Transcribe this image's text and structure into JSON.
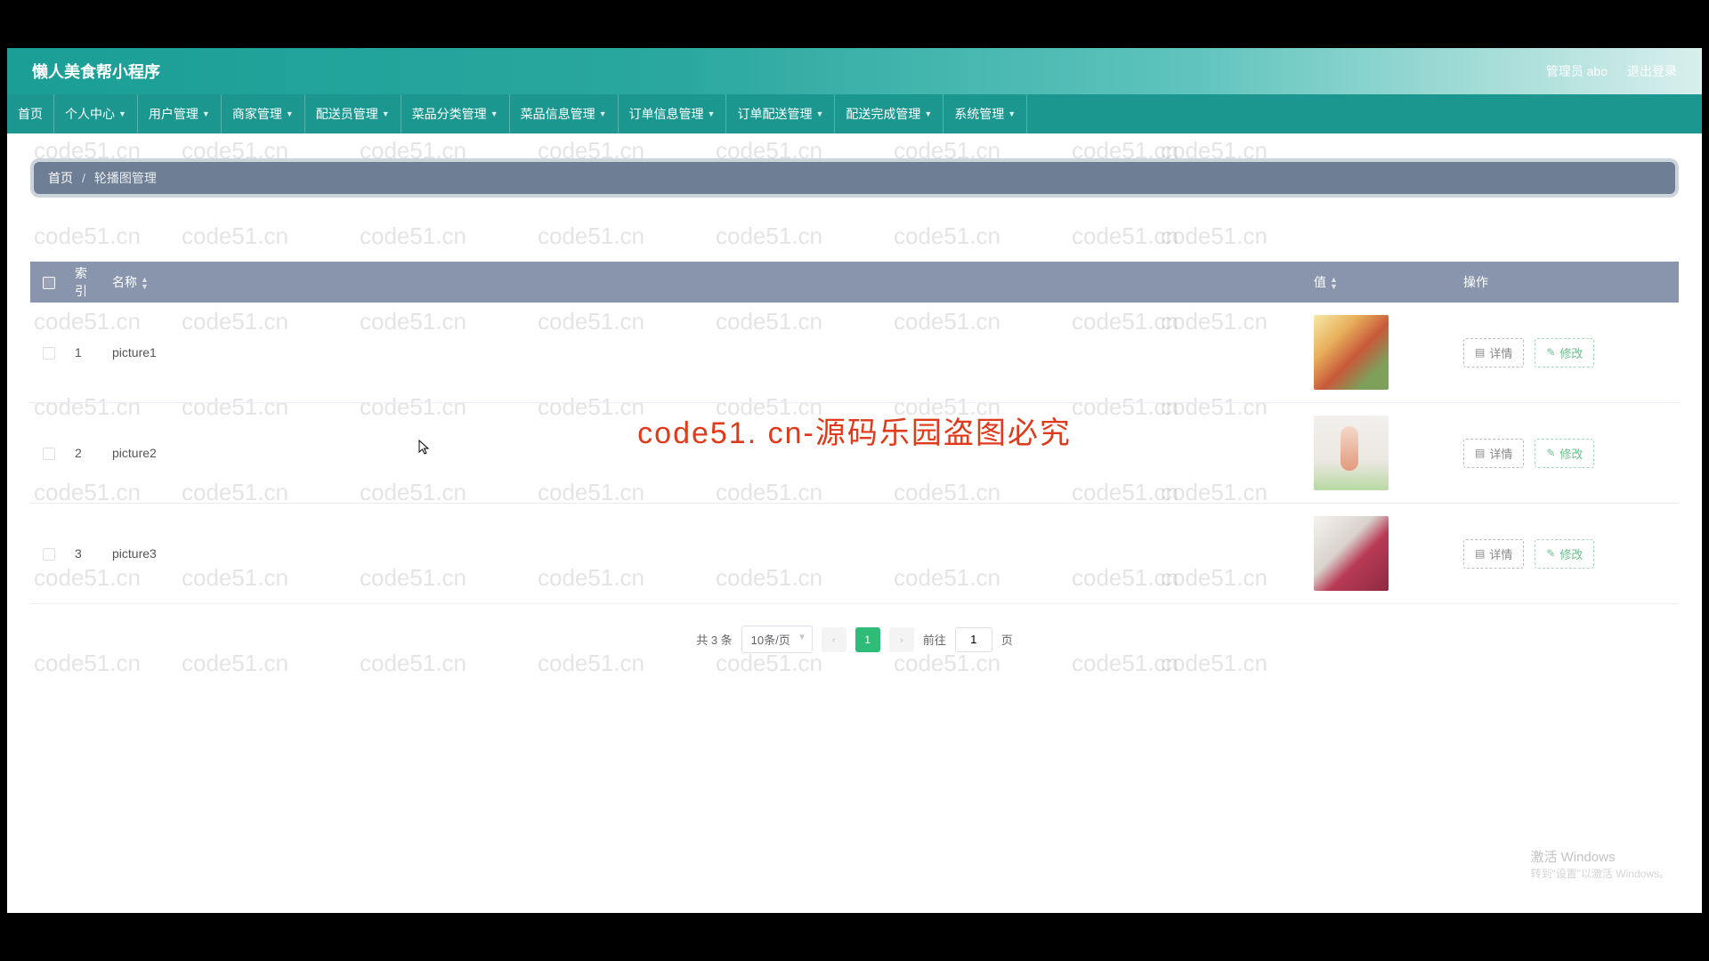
{
  "header": {
    "app_title": "懒人美食帮小程序",
    "admin_label": "管理员 abo",
    "logout": "退出登录"
  },
  "nav": [
    {
      "label": "首页",
      "dropdown": false
    },
    {
      "label": "个人中心",
      "dropdown": true
    },
    {
      "label": "用户管理",
      "dropdown": true
    },
    {
      "label": "商家管理",
      "dropdown": true
    },
    {
      "label": "配送员管理",
      "dropdown": true
    },
    {
      "label": "菜品分类管理",
      "dropdown": true
    },
    {
      "label": "菜品信息管理",
      "dropdown": true
    },
    {
      "label": "订单信息管理",
      "dropdown": true
    },
    {
      "label": "订单配送管理",
      "dropdown": true
    },
    {
      "label": "配送完成管理",
      "dropdown": true
    },
    {
      "label": "系统管理",
      "dropdown": true
    }
  ],
  "breadcrumb": {
    "home": "首页",
    "sep": "/",
    "current": "轮播图管理"
  },
  "table": {
    "headers": {
      "index": "索引",
      "name": "名称",
      "value": "值",
      "ops": "操作"
    },
    "rows": [
      {
        "idx": "1",
        "name": "picture1"
      },
      {
        "idx": "2",
        "name": "picture2"
      },
      {
        "idx": "3",
        "name": "picture3"
      }
    ],
    "btn_detail": "详情",
    "btn_edit": "修改"
  },
  "pagination": {
    "total_text": "共 3 条",
    "per_page": "10条/页",
    "current": "1",
    "goto_prefix": "前往",
    "goto_value": "1",
    "goto_suffix": "页"
  },
  "overlay": "code51. cn-源码乐园盗图必究",
  "watermark": "code51.cn",
  "activate": {
    "line1": "激活 Windows",
    "line2": "转到\"设置\"以激活 Windows。"
  }
}
